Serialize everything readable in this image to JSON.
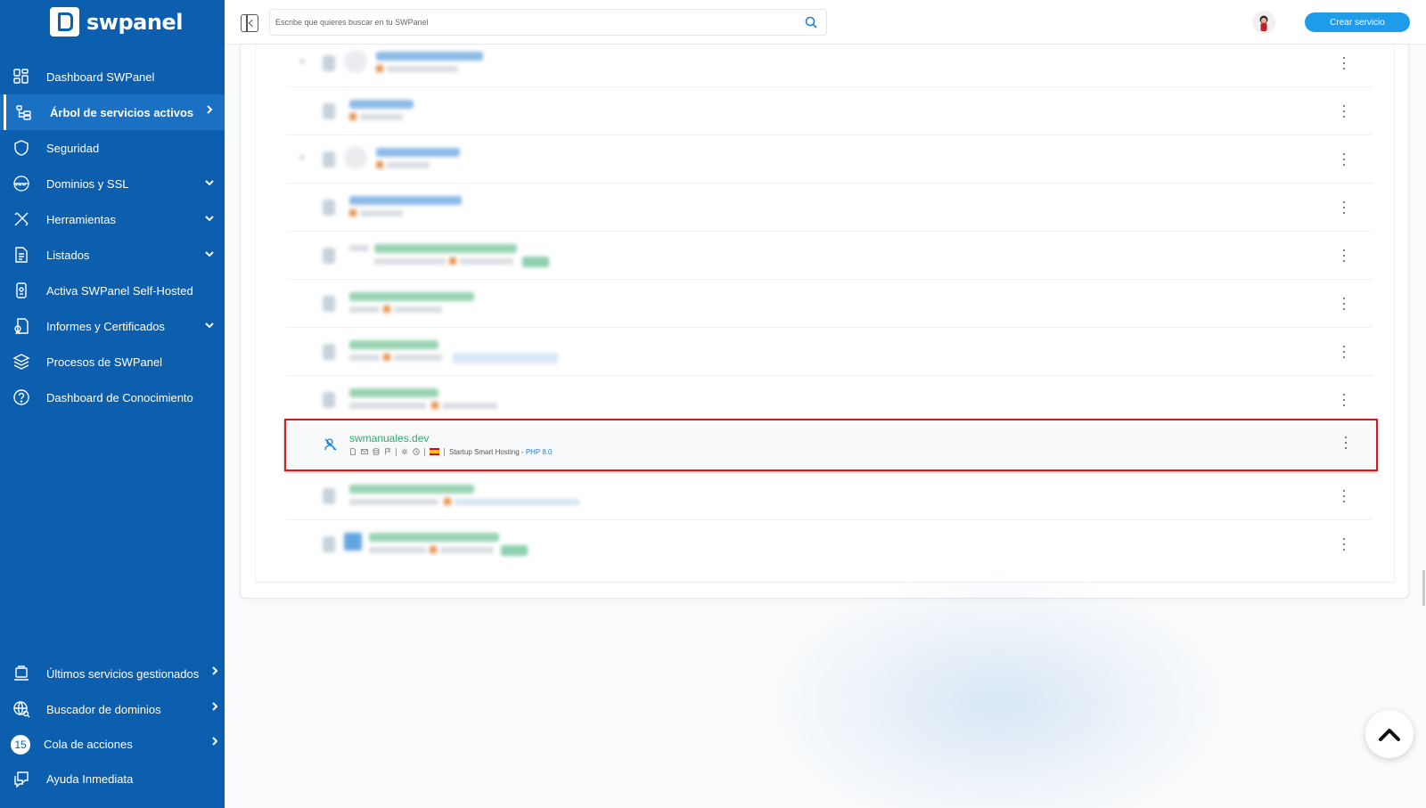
{
  "brand": {
    "name": "swpanel"
  },
  "sidebar": {
    "items": [
      {
        "label": "Dashboard SWPanel",
        "icon": "dashboard-grid-icon"
      },
      {
        "label": "Árbol de servicios activos",
        "icon": "service-tree-icon",
        "active": true
      },
      {
        "label": "Seguridad",
        "icon": "shield-icon"
      },
      {
        "label": "Dominios y SSL",
        "icon": "www-globe-icon"
      },
      {
        "label": "Herramientas",
        "icon": "tools-icon"
      },
      {
        "label": "Listados",
        "icon": "document-list-icon"
      },
      {
        "label": "Activa SWPanel Self-Hosted",
        "icon": "self-hosted-icon"
      },
      {
        "label": "Informes y Certificados",
        "icon": "report-icon"
      },
      {
        "label": "Procesos de SWPanel",
        "icon": "layers-icon"
      },
      {
        "label": "Dashboard de Conocimiento",
        "icon": "help-circle-icon"
      }
    ],
    "bottom_items": [
      {
        "label": "Últimos servicios gestionados",
        "icon": "recent-services-icon"
      },
      {
        "label": "Buscador de dominios",
        "icon": "domain-search-icon"
      },
      {
        "label": "Cola de acciones",
        "badge": "15"
      },
      {
        "label": "Ayuda Inmediata",
        "icon": "chat-help-icon"
      }
    ]
  },
  "topbar": {
    "search_placeholder": "Escribe que quieres buscar en tu SWPanel",
    "create_button": "Crear servicio"
  },
  "highlighted_service": {
    "name": "swmanuales.dev",
    "plan": "Startup Smart Hosting - ",
    "php": "PHP 8.0",
    "country_flag": "spain-flag"
  },
  "colors": {
    "sidebar_bg": "#0b5fae",
    "accent": "#1e9be9",
    "highlight_border": "#d71920",
    "service_name": "#2daa6a"
  }
}
